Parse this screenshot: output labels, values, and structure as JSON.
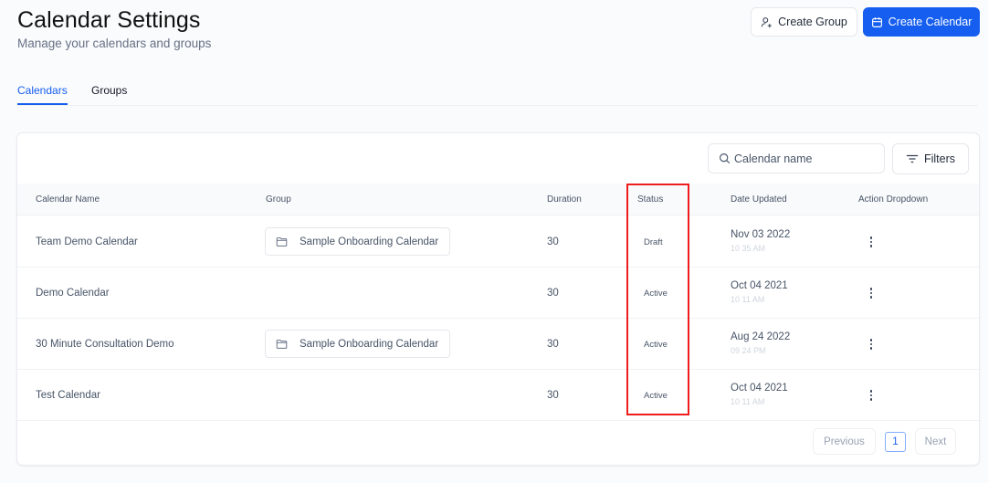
{
  "header": {
    "title": "Calendar Settings",
    "subtitle": "Manage your calendars and groups",
    "create_group_label": "Create Group",
    "create_calendar_label": "Create Calendar"
  },
  "tabs": [
    {
      "label": "Calendars",
      "active": true
    },
    {
      "label": "Groups",
      "active": false
    }
  ],
  "toolbar": {
    "search_placeholder": "Calendar name",
    "search_value": "",
    "filters_label": "Filters"
  },
  "table": {
    "columns": [
      "Calendar Name",
      "Group",
      "Duration",
      "Status",
      "Date Updated",
      "Action Dropdown"
    ],
    "rows": [
      {
        "name": "Team Demo Calendar",
        "group": "Sample Onboarding Calendar",
        "duration": "30",
        "status": "Draft",
        "date": "Nov 03 2022",
        "time": "10 35 AM"
      },
      {
        "name": "Demo Calendar",
        "group": "",
        "duration": "30",
        "status": "Active",
        "date": "Oct 04 2021",
        "time": "10 11 AM"
      },
      {
        "name": "30 Minute Consultation Demo",
        "group": "Sample Onboarding Calendar",
        "duration": "30",
        "status": "Active",
        "date": "Aug 24 2022",
        "time": "09 24 PM"
      },
      {
        "name": "Test Calendar",
        "group": "",
        "duration": "30",
        "status": "Active",
        "date": "Oct 04 2021",
        "time": "10 11 AM"
      }
    ]
  },
  "pagination": {
    "previous_label": "Previous",
    "current_page": "1",
    "next_label": "Next"
  },
  "colors": {
    "accent": "#155eef",
    "highlight_box": "#ee1c1c"
  }
}
